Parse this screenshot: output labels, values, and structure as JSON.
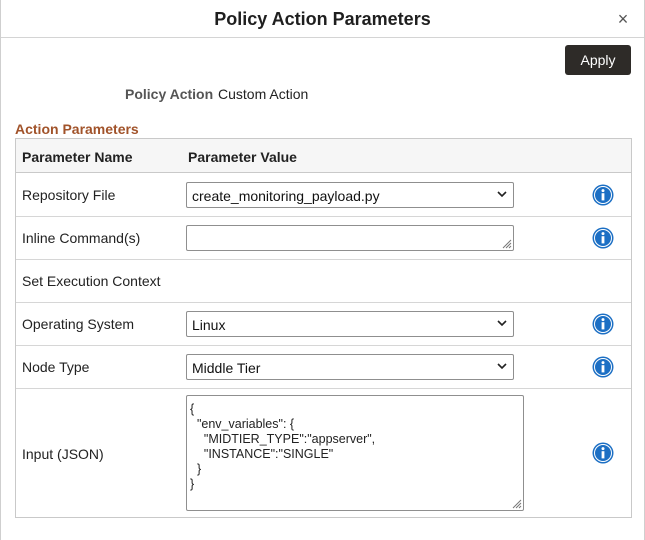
{
  "dialog": {
    "title": "Policy Action Parameters",
    "close_glyph": "×",
    "apply_label": "Apply"
  },
  "policy_action": {
    "label": "Policy Action",
    "value": "Custom Action"
  },
  "section": {
    "title": "Action Parameters"
  },
  "grid": {
    "headers": [
      "Parameter Name",
      "Parameter Value"
    ],
    "rows": [
      {
        "name": "Repository File",
        "control": "select",
        "value": "create_monitoring_payload.py",
        "info": true
      },
      {
        "name": "Inline Command(s)",
        "control": "textarea",
        "value": "",
        "info": true
      },
      {
        "name": "Set Execution Context",
        "control": "none",
        "info": false
      },
      {
        "name": "Operating System",
        "control": "select",
        "value": "Linux",
        "info": true
      },
      {
        "name": "Node Type",
        "control": "select",
        "value": "Middle Tier",
        "info": true
      },
      {
        "name": "Input (JSON)",
        "control": "textarea",
        "value": "{\n  \"env_variables\": {\n    \"MIDTIER_TYPE\":\"appserver\",\n    \"INSTANCE\":\"SINGLE\"\n  }\n}",
        "info": true
      }
    ]
  },
  "colors": {
    "section_title": "#a1532a",
    "apply_button": "#2e2b28",
    "info_icon": "#1c6fc4"
  },
  "icons": {
    "info": "info-circle-icon",
    "dropdown": "chevron-down-icon",
    "close": "close-icon",
    "resize": "resize-grip-icon"
  }
}
